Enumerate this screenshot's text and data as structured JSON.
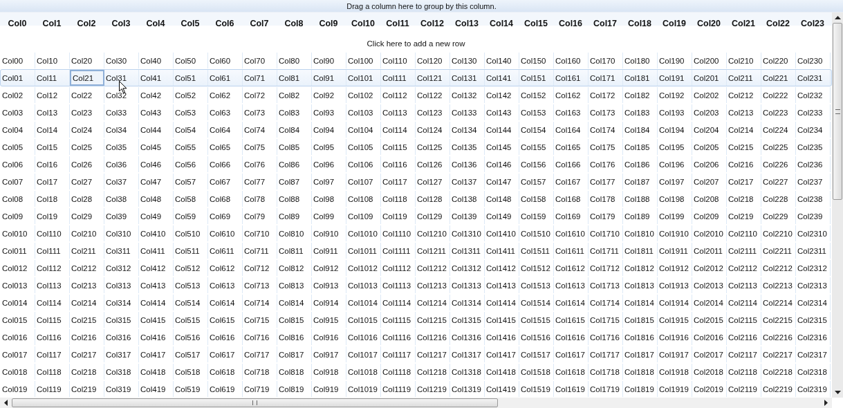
{
  "group_panel": {
    "hint": "Drag a column here to group by this column."
  },
  "new_row": {
    "label": "Click here to add a new row"
  },
  "columns": [
    {
      "label": "Col0",
      "current": false
    },
    {
      "label": "Col1",
      "current": false
    },
    {
      "label": "Col2",
      "current": true
    },
    {
      "label": "Col3",
      "current": false
    },
    {
      "label": "Col4",
      "current": false
    },
    {
      "label": "Col5",
      "current": false
    },
    {
      "label": "Col6",
      "current": false
    },
    {
      "label": "Col7",
      "current": false
    },
    {
      "label": "Col8",
      "current": false
    },
    {
      "label": "Col9",
      "current": false
    },
    {
      "label": "Col10",
      "current": false
    },
    {
      "label": "Col11",
      "current": false
    },
    {
      "label": "Col12",
      "current": false
    },
    {
      "label": "Col13",
      "current": false
    },
    {
      "label": "Col14",
      "current": false
    },
    {
      "label": "Col15",
      "current": false
    },
    {
      "label": "Col16",
      "current": false
    },
    {
      "label": "Col17",
      "current": false
    },
    {
      "label": "Col18",
      "current": false
    },
    {
      "label": "Col19",
      "current": false
    },
    {
      "label": "Col20",
      "current": false
    },
    {
      "label": "Col21",
      "current": false
    },
    {
      "label": "Col22",
      "current": false
    },
    {
      "label": "Col23",
      "current": false
    }
  ],
  "rows": [
    {
      "selected": false,
      "cells": [
        "Col00",
        "Col10",
        "Col20",
        "Col30",
        "Col40",
        "Col50",
        "Col60",
        "Col70",
        "Col80",
        "Col90",
        "Col100",
        "Col110",
        "Col120",
        "Col130",
        "Col140",
        "Col150",
        "Col160",
        "Col170",
        "Col180",
        "Col190",
        "Col200",
        "Col210",
        "Col220",
        "Col230"
      ]
    },
    {
      "selected": true,
      "cells": [
        "Col01",
        "Col11",
        "Col21",
        "Col31",
        "Col41",
        "Col51",
        "Col61",
        "Col71",
        "Col81",
        "Col91",
        "Col101",
        "Col111",
        "Col121",
        "Col131",
        "Col141",
        "Col151",
        "Col161",
        "Col171",
        "Col181",
        "Col191",
        "Col201",
        "Col211",
        "Col221",
        "Col231"
      ]
    },
    {
      "selected": false,
      "cells": [
        "Col02",
        "Col12",
        "Col22",
        "Col32",
        "Col42",
        "Col52",
        "Col62",
        "Col72",
        "Col82",
        "Col92",
        "Col102",
        "Col112",
        "Col122",
        "Col132",
        "Col142",
        "Col152",
        "Col162",
        "Col172",
        "Col182",
        "Col192",
        "Col202",
        "Col212",
        "Col222",
        "Col232"
      ]
    },
    {
      "selected": false,
      "cells": [
        "Col03",
        "Col13",
        "Col23",
        "Col33",
        "Col43",
        "Col53",
        "Col63",
        "Col73",
        "Col83",
        "Col93",
        "Col103",
        "Col113",
        "Col123",
        "Col133",
        "Col143",
        "Col153",
        "Col163",
        "Col173",
        "Col183",
        "Col193",
        "Col203",
        "Col213",
        "Col223",
        "Col233"
      ]
    },
    {
      "selected": false,
      "cells": [
        "Col04",
        "Col14",
        "Col24",
        "Col34",
        "Col44",
        "Col54",
        "Col64",
        "Col74",
        "Col84",
        "Col94",
        "Col104",
        "Col114",
        "Col124",
        "Col134",
        "Col144",
        "Col154",
        "Col164",
        "Col174",
        "Col184",
        "Col194",
        "Col204",
        "Col214",
        "Col224",
        "Col234"
      ]
    },
    {
      "selected": false,
      "cells": [
        "Col05",
        "Col15",
        "Col25",
        "Col35",
        "Col45",
        "Col55",
        "Col65",
        "Col75",
        "Col85",
        "Col95",
        "Col105",
        "Col115",
        "Col125",
        "Col135",
        "Col145",
        "Col155",
        "Col165",
        "Col175",
        "Col185",
        "Col195",
        "Col205",
        "Col215",
        "Col225",
        "Col235"
      ]
    },
    {
      "selected": false,
      "cells": [
        "Col06",
        "Col16",
        "Col26",
        "Col36",
        "Col46",
        "Col56",
        "Col66",
        "Col76",
        "Col86",
        "Col96",
        "Col106",
        "Col116",
        "Col126",
        "Col136",
        "Col146",
        "Col156",
        "Col166",
        "Col176",
        "Col186",
        "Col196",
        "Col206",
        "Col216",
        "Col226",
        "Col236"
      ]
    },
    {
      "selected": false,
      "cells": [
        "Col07",
        "Col17",
        "Col27",
        "Col37",
        "Col47",
        "Col57",
        "Col67",
        "Col77",
        "Col87",
        "Col97",
        "Col107",
        "Col117",
        "Col127",
        "Col137",
        "Col147",
        "Col157",
        "Col167",
        "Col177",
        "Col187",
        "Col197",
        "Col207",
        "Col217",
        "Col227",
        "Col237"
      ]
    },
    {
      "selected": false,
      "cells": [
        "Col08",
        "Col18",
        "Col28",
        "Col38",
        "Col48",
        "Col58",
        "Col68",
        "Col78",
        "Col88",
        "Col98",
        "Col108",
        "Col118",
        "Col128",
        "Col138",
        "Col148",
        "Col158",
        "Col168",
        "Col178",
        "Col188",
        "Col198",
        "Col208",
        "Col218",
        "Col228",
        "Col238"
      ]
    },
    {
      "selected": false,
      "cells": [
        "Col09",
        "Col19",
        "Col29",
        "Col39",
        "Col49",
        "Col59",
        "Col69",
        "Col79",
        "Col89",
        "Col99",
        "Col109",
        "Col119",
        "Col129",
        "Col139",
        "Col149",
        "Col159",
        "Col169",
        "Col179",
        "Col189",
        "Col199",
        "Col209",
        "Col219",
        "Col229",
        "Col239"
      ]
    },
    {
      "selected": false,
      "cells": [
        "Col010",
        "Col110",
        "Col210",
        "Col310",
        "Col410",
        "Col510",
        "Col610",
        "Col710",
        "Col810",
        "Col910",
        "Col1010",
        "Col1110",
        "Col1210",
        "Col1310",
        "Col1410",
        "Col1510",
        "Col1610",
        "Col1710",
        "Col1810",
        "Col1910",
        "Col2010",
        "Col2110",
        "Col2210",
        "Col2310"
      ]
    },
    {
      "selected": false,
      "cells": [
        "Col011",
        "Col111",
        "Col211",
        "Col311",
        "Col411",
        "Col511",
        "Col611",
        "Col711",
        "Col811",
        "Col911",
        "Col1011",
        "Col1111",
        "Col1211",
        "Col1311",
        "Col1411",
        "Col1511",
        "Col1611",
        "Col1711",
        "Col1811",
        "Col1911",
        "Col2011",
        "Col2111",
        "Col2211",
        "Col2311"
      ]
    },
    {
      "selected": false,
      "cells": [
        "Col012",
        "Col112",
        "Col212",
        "Col312",
        "Col412",
        "Col512",
        "Col612",
        "Col712",
        "Col812",
        "Col912",
        "Col1012",
        "Col1112",
        "Col1212",
        "Col1312",
        "Col1412",
        "Col1512",
        "Col1612",
        "Col1712",
        "Col1812",
        "Col1912",
        "Col2012",
        "Col2112",
        "Col2212",
        "Col2312"
      ]
    },
    {
      "selected": false,
      "cells": [
        "Col013",
        "Col113",
        "Col213",
        "Col313",
        "Col413",
        "Col513",
        "Col613",
        "Col713",
        "Col813",
        "Col913",
        "Col1013",
        "Col1113",
        "Col1213",
        "Col1313",
        "Col1413",
        "Col1513",
        "Col1613",
        "Col1713",
        "Col1813",
        "Col1913",
        "Col2013",
        "Col2113",
        "Col2213",
        "Col2313"
      ]
    },
    {
      "selected": false,
      "cells": [
        "Col014",
        "Col114",
        "Col214",
        "Col314",
        "Col414",
        "Col514",
        "Col614",
        "Col714",
        "Col814",
        "Col914",
        "Col1014",
        "Col1114",
        "Col1214",
        "Col1314",
        "Col1414",
        "Col1514",
        "Col1614",
        "Col1714",
        "Col1814",
        "Col1914",
        "Col2014",
        "Col2114",
        "Col2214",
        "Col2314"
      ]
    },
    {
      "selected": false,
      "cells": [
        "Col015",
        "Col115",
        "Col215",
        "Col315",
        "Col415",
        "Col515",
        "Col615",
        "Col715",
        "Col815",
        "Col915",
        "Col1015",
        "Col1115",
        "Col1215",
        "Col1315",
        "Col1415",
        "Col1515",
        "Col1615",
        "Col1715",
        "Col1815",
        "Col1915",
        "Col2015",
        "Col2115",
        "Col2215",
        "Col2315"
      ]
    },
    {
      "selected": false,
      "cells": [
        "Col016",
        "Col116",
        "Col216",
        "Col316",
        "Col416",
        "Col516",
        "Col616",
        "Col716",
        "Col816",
        "Col916",
        "Col1016",
        "Col1116",
        "Col1216",
        "Col1316",
        "Col1416",
        "Col1516",
        "Col1616",
        "Col1716",
        "Col1816",
        "Col1916",
        "Col2016",
        "Col2116",
        "Col2216",
        "Col2316"
      ]
    },
    {
      "selected": false,
      "cells": [
        "Col017",
        "Col117",
        "Col217",
        "Col317",
        "Col417",
        "Col517",
        "Col617",
        "Col717",
        "Col817",
        "Col917",
        "Col1017",
        "Col1117",
        "Col1217",
        "Col1317",
        "Col1417",
        "Col1517",
        "Col1617",
        "Col1717",
        "Col1817",
        "Col1917",
        "Col2017",
        "Col2117",
        "Col2217",
        "Col2317"
      ]
    },
    {
      "selected": false,
      "cells": [
        "Col018",
        "Col118",
        "Col218",
        "Col318",
        "Col418",
        "Col518",
        "Col618",
        "Col718",
        "Col818",
        "Col918",
        "Col1018",
        "Col1118",
        "Col1218",
        "Col1318",
        "Col1418",
        "Col1518",
        "Col1618",
        "Col1718",
        "Col1818",
        "Col1918",
        "Col2018",
        "Col2118",
        "Col2218",
        "Col2318"
      ]
    },
    {
      "selected": false,
      "cells": [
        "Col019",
        "Col119",
        "Col219",
        "Col319",
        "Col419",
        "Col519",
        "Col619",
        "Col719",
        "Col819",
        "Col919",
        "Col1019",
        "Col1119",
        "Col1219",
        "Col1319",
        "Col1419",
        "Col1519",
        "Col1619",
        "Col1719",
        "Col1819",
        "Col1919",
        "Col2019",
        "Col2119",
        "Col2219",
        "Col2319"
      ]
    }
  ]
}
